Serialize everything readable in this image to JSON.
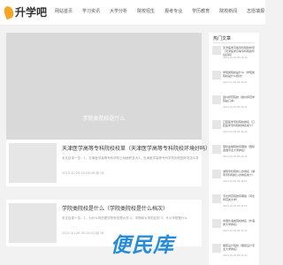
{
  "brand": {
    "name": "升学吧"
  },
  "nav": [
    "网站首页",
    "学习资讯",
    "大学分析",
    "院校招生",
    "报考专业",
    "学历教育",
    "院校新闻",
    "志愿填报"
  ],
  "hero": {
    "caption": "学院类院校是什么"
  },
  "posts": [
    {
      "title": "天津医学高等专科院校校草（天津医学高等专科院校环境好吗）",
      "excerpt": "本文目录一览：1、天津医学高等专科学校占地面积多大2、天津医学高等专科学校的校园环境怎么样",
      "meta": "2023-10-26 05:26:49  阅 16"
    },
    {
      "title": "学院类院校是什么（学院类院校是什么档次）",
      "excerpt": "本文目录一览：1、为什么有的是学院有的是大学 2、学院和大学的区别 3、什么学院是什么",
      "meta": "2023-10-26 05:26:41  阅 18"
    }
  ],
  "sidebar": {
    "title": "热门文章",
    "items": [
      {
        "text": "天津医学高等专科院校校草（天津医学高等专科院校环境好吗）",
        "date": "2023-10-26 05:26:49"
      },
      {
        "text": "学院类院校是什么（学院类院校是什么档次）",
        "date": "2023-10-26 05:26:41"
      },
      {
        "text": "赣州师范院校（赣州师范学院是几本）",
        "date": "2023-10-26 05:26:31"
      },
      {
        "text": "口腔医学专科院校排名（口腔医学专科院校排名前十）",
        "date": "2023-10-26 05:26:20"
      },
      {
        "text": "国际金融院校有哪些（国际金融专业大学排名）",
        "date": "2023-10-26 05:26:11"
      },
      {
        "text": "湖南专科院校公办排名（湖南专科院校公办排名前十）",
        "date": "2023-10-26 05:26:02"
      },
      {
        "text": "河北师范院校有哪些（河北师范类大学）",
        "date": "2023-10-26 05:25:54"
      },
      {
        "text": "中国外语类院校排名（外语类大学排名）",
        "date": "2023-10-26 05:25:44"
      },
      {
        "text": "服装设计院校（服装设计专业大学排名）",
        "date": "2023-10-26 05:25:33"
      }
    ]
  },
  "watermark": "便民库",
  "colors": {
    "brand_orange": "#f5a623",
    "watermark_blue": "#1c87d6"
  }
}
